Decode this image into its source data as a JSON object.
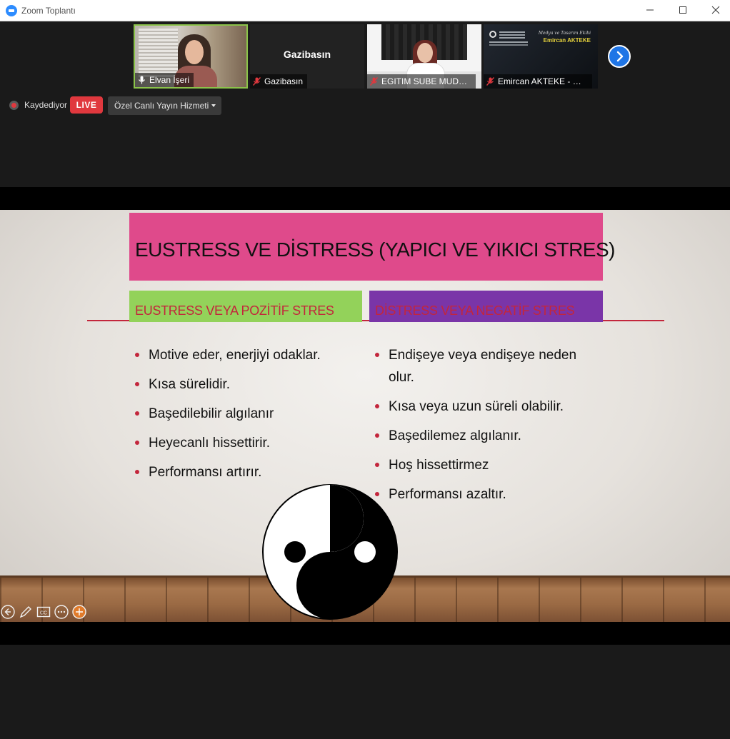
{
  "window": {
    "title": "Zoom Toplantı",
    "controls": [
      "minimize-icon",
      "maximize-icon",
      "close-icon"
    ]
  },
  "gallery": {
    "tiles": [
      {
        "name": "Elvan İşeri",
        "mic": "unmuted",
        "active": true,
        "mic_icon": "mic-icon"
      },
      {
        "name": "Gazibasın",
        "center_name": "Gazibasın",
        "mic": "muted",
        "mic_icon": "mic-muted-icon"
      },
      {
        "name": "EGITIM SUBE MUDUR...",
        "mic": "muted",
        "mic_icon": "mic-muted-icon"
      },
      {
        "name": "Emircan AKTEKE - GU...",
        "mic": "muted",
        "mic_icon": "mic-muted-icon",
        "card_tag": "Medya ve Tasarım Ekibi",
        "card_name": "Emircan AKTEKE"
      }
    ],
    "next_icon": "chevron-right-icon"
  },
  "recording": {
    "label": "Kaydediyor",
    "live_badge": "LIVE",
    "stream_service": "Özel Canlı Yayın Hizmeti"
  },
  "slide": {
    "title": "EUSTRESS VE DİSTRESS (YAPICI VE YIKICI STRES)",
    "left_heading": "EUSTRESS VEYA POZİTİF STRES",
    "right_heading": "DİSTRESS VEYA NEGATİF STRES",
    "left_items": [
      "Motive eder, enerjiyi odaklar.",
      "Kısa sürelidir.",
      "Başedilebilir algılanır",
      "Heyecanlı hissettirir.",
      "Performansı artırır."
    ],
    "right_items": [
      "Endişeye veya endişeye neden olur.",
      "Kısa veya uzun süreli olabilir.",
      "Başedilemez algılanır.",
      "Hoş hissettirmez",
      "Performansı azaltır."
    ],
    "colors": {
      "title_bg": "#df4a8b",
      "left_head_bg": "#93d25a",
      "right_head_bg": "#7a35a8",
      "accent": "#c3263c"
    }
  },
  "annotation_toolbar": {
    "icons": [
      "back-arrow-icon",
      "pen-icon",
      "cc-icon",
      "more-icon",
      "pointer-icon"
    ]
  }
}
